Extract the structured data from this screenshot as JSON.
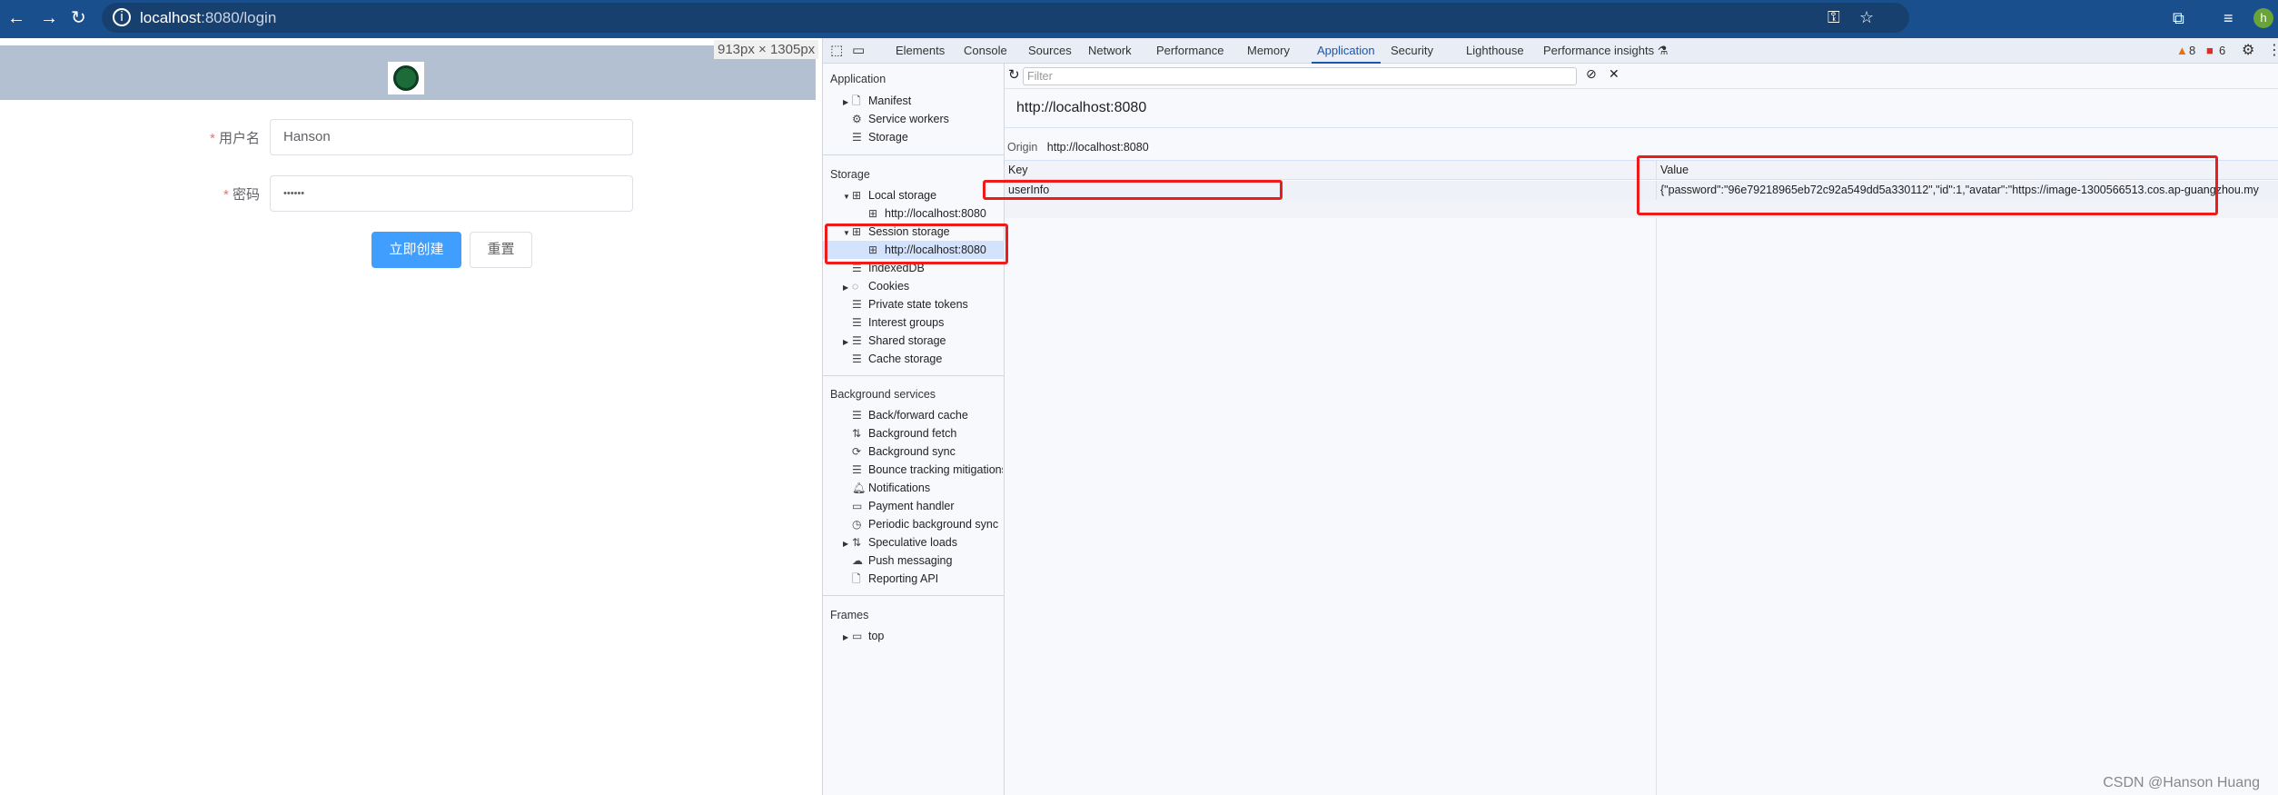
{
  "browser": {
    "url_host": "localhost",
    "url_path": ":8080/login",
    "icons": [
      "back-icon",
      "forward-icon",
      "reload-icon",
      "info-icon",
      "key-icon",
      "star-icon",
      "extensions-icon",
      "media-icon",
      "profile-avatar"
    ],
    "profile_initial": "h"
  },
  "page": {
    "viewport_size": "913px × 1305px",
    "form": {
      "username_label": "用户名",
      "username_value": "Hanson",
      "password_label": "密码",
      "password_value": "••••••",
      "required_mark": "*",
      "submit_label": "立即创建",
      "reset_label": "重置"
    }
  },
  "devtools": {
    "tabs": [
      "Elements",
      "Console",
      "Sources",
      "Network",
      "Performance",
      "Memory",
      "Application",
      "Security",
      "Lighthouse",
      "Performance insights"
    ],
    "active_tab": "Application",
    "warnings_count": "8",
    "errors_count": "6",
    "sidebar": {
      "application_heading": "Application",
      "application_items": [
        "Manifest",
        "Service workers",
        "Storage"
      ],
      "storage_heading": "Storage",
      "storage_items": [
        "Local storage",
        "http://localhost:8080",
        "Session storage",
        "http://localhost:8080",
        "IndexedDB",
        "Cookies",
        "Private state tokens",
        "Interest groups",
        "Shared storage",
        "Cache storage"
      ],
      "background_heading": "Background services",
      "background_items": [
        "Back/forward cache",
        "Background fetch",
        "Background sync",
        "Bounce tracking mitigations",
        "Notifications",
        "Payment handler",
        "Periodic background sync",
        "Speculative loads",
        "Push messaging",
        "Reporting API"
      ],
      "frames_heading": "Frames",
      "frames_items": [
        "top"
      ],
      "selected": "Session storage > http://localhost:8080"
    },
    "main": {
      "filter_placeholder": "Filter",
      "origin_title": "http://localhost:8080",
      "origin_label": "Origin",
      "origin_value": "http://localhost:8080",
      "columns": [
        "Key",
        "Value"
      ],
      "rows": [
        {
          "key": "userInfo",
          "value": "{\"password\":\"96e79218965eb72c92a549dd5a330112\",\"id\":1,\"avatar\":\"https://image-1300566513.cos.ap-guangzhou.my"
        }
      ]
    },
    "highlight_color": "#ee1b1b"
  },
  "watermark": "CSDN @Hanson Huang"
}
